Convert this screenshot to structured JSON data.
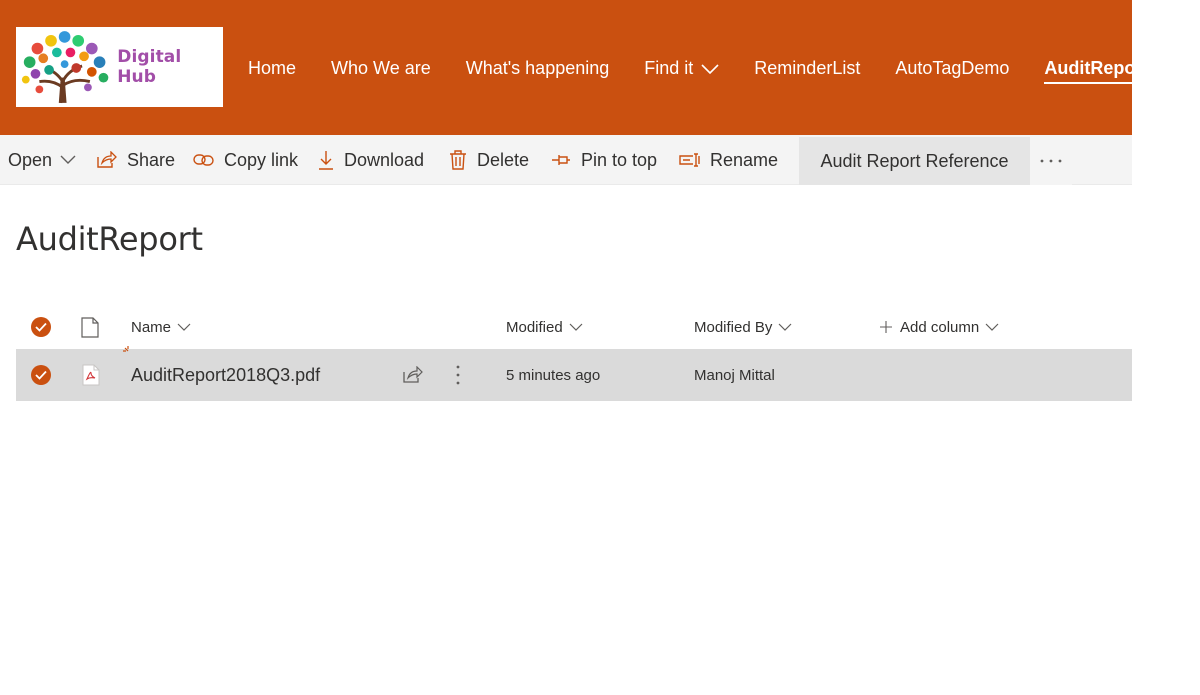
{
  "header": {
    "logo_text": "Digital Hub",
    "nav": [
      {
        "label": "Home"
      },
      {
        "label": "Who We are"
      },
      {
        "label": "What's happening"
      },
      {
        "label": "Find it"
      },
      {
        "label": "ReminderList"
      },
      {
        "label": "AutoTagDemo"
      },
      {
        "label": "AuditReport"
      }
    ]
  },
  "commandbar": {
    "open": "Open",
    "share": "Share",
    "copy_link": "Copy link",
    "download": "Download",
    "delete": "Delete",
    "pin": "Pin to top",
    "rename": "Rename",
    "reference": "Audit Report Reference"
  },
  "page": {
    "title": "AuditReport"
  },
  "list": {
    "columns": {
      "name": "Name",
      "modified": "Modified",
      "modified_by": "Modified By",
      "add_column": "Add column"
    },
    "rows": [
      {
        "name": "AuditReport2018Q3.pdf",
        "modified": "5 minutes ago",
        "modified_by": "Manoj Mittal",
        "selected": true
      }
    ]
  },
  "colors": {
    "brand": "#ca5010",
    "command_bar_bg": "#f4f4f4",
    "selected_row_bg": "#dadada",
    "logo_text": "#a24ea8"
  }
}
